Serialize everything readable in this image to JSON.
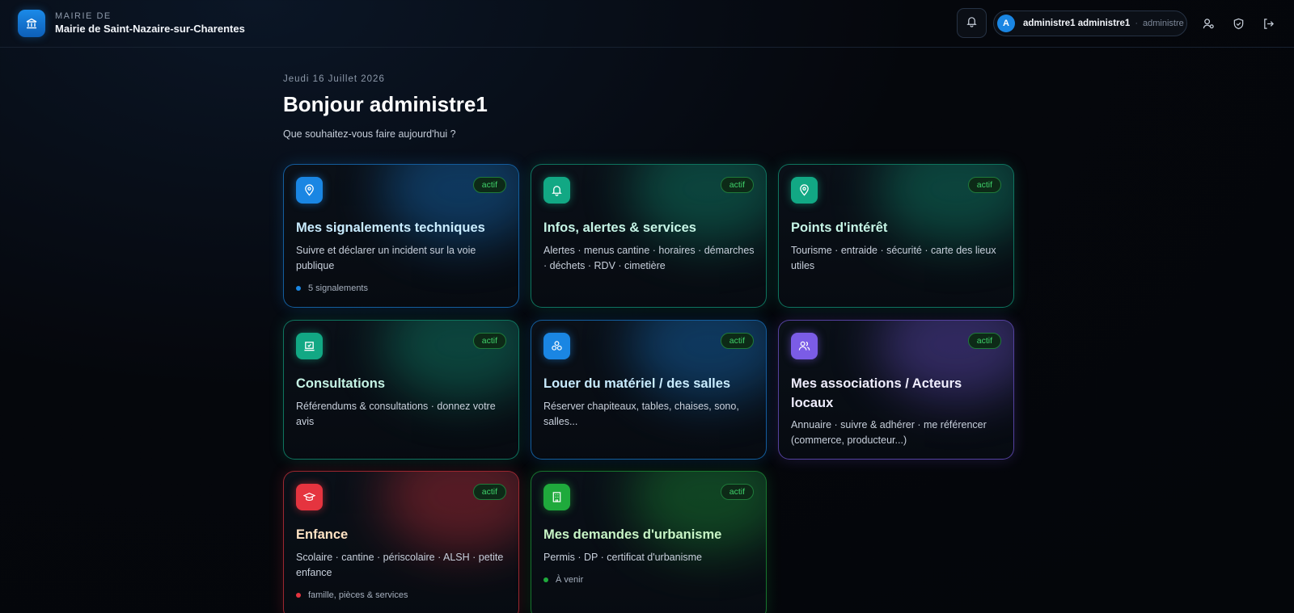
{
  "header": {
    "brand_small": "MAIRIE DE",
    "brand_name": "Mairie de Saint-Nazaire-sur-Charentes",
    "notifications_icon": "bell-icon",
    "user": {
      "avatar_letter": "A",
      "name": "administre1 administre1",
      "separator": "·",
      "role": "administre"
    },
    "actions": [
      "user-settings-icon",
      "shield-icon",
      "logout-icon"
    ]
  },
  "main": {
    "date": "Jeudi 16 Juillet 2026",
    "greeting": "Bonjour administre1",
    "subtitle": "Que souhaitez-vous faire aujourd'hui ?"
  },
  "cards": [
    {
      "title": "Mes signalements techniques",
      "description": "Suivre et déclarer un incident sur la voie publique",
      "badge": "actif",
      "footer": "5 signalements",
      "icon": "map-pin-icon",
      "accent": "#1a86e3",
      "title_color": "#c9ecff"
    },
    {
      "title": "Infos, alertes & services",
      "description": "Alertes · menus cantine · horaires · démarches · déchets · RDV · cimetière",
      "badge": "actif",
      "footer": "",
      "icon": "bell-icon",
      "accent": "#12a884",
      "title_color": "#c6f5e6"
    },
    {
      "title": "Points d'intérêt",
      "description": "Tourisme · entraide · sécurité · carte des lieux utiles",
      "badge": "actif",
      "footer": "",
      "icon": "map-pin-icon",
      "accent": "#12a884",
      "title_color": "#c6f5e6"
    },
    {
      "title": "Consultations",
      "description": "Référendums & consultations · donnez votre avis",
      "badge": "actif",
      "footer": "",
      "icon": "ballot-box-icon",
      "accent": "#12a884",
      "title_color": "#c6f5e6"
    },
    {
      "title": "Louer du matériel / des salles",
      "description": "Réserver chapiteaux, tables, chaises, sono, salles...",
      "badge": "actif",
      "footer": "",
      "icon": "boxes-icon",
      "accent": "#1a86e3",
      "title_color": "#c9ecff"
    },
    {
      "title": "Mes associations / Acteurs locaux",
      "description": "Annuaire · suivre & adhérer · me référencer (commerce, producteur...)",
      "badge": "actif",
      "footer": "",
      "icon": "users-icon",
      "accent": "#7b5ce6",
      "title_color": "#f0eefe"
    },
    {
      "title": "Enfance",
      "description": "Scolaire · cantine · périscolaire · ALSH · petite enfance",
      "badge": "actif",
      "footer": "famille, pièces & services",
      "icon": "graduation-cap-icon",
      "accent": "#e5343f",
      "title_color": "#ffe3c4"
    },
    {
      "title": "Mes demandes d'urbanisme",
      "description": "Permis · DP · certificat d'urbanisme",
      "badge": "actif",
      "footer": "À venir",
      "icon": "building-icon",
      "accent": "#1faa3c",
      "title_color": "#c8f5c6"
    }
  ]
}
